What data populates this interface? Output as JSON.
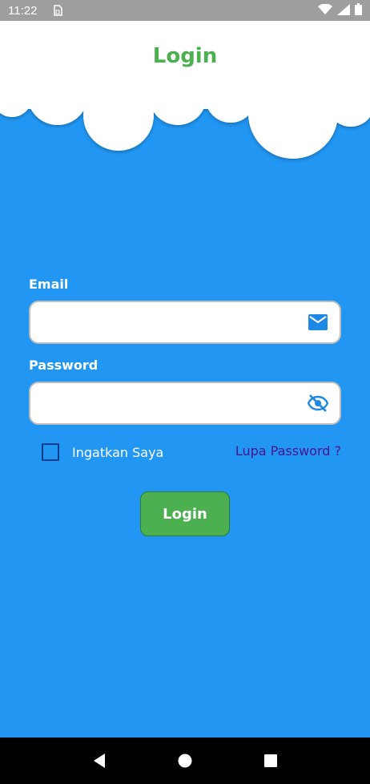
{
  "status_bar": {
    "time": "11:22",
    "icons": [
      "sim-card-icon",
      "wifi-icon",
      "signal-icon",
      "battery-icon"
    ]
  },
  "header": {
    "title": "Login",
    "title_color": "#4CAF50"
  },
  "form": {
    "email": {
      "label": "Email",
      "value": "",
      "placeholder": "",
      "icon": "mail-icon"
    },
    "password": {
      "label": "Password",
      "value": "",
      "placeholder": "",
      "icon": "eye-off-icon"
    },
    "remember": {
      "label": "Ingatkan Saya",
      "checked": false
    },
    "forgot_label": "Lupa Password ?",
    "login_label": "Login"
  },
  "nav_bar": {
    "buttons": [
      "back-icon",
      "home-icon",
      "recents-icon"
    ]
  },
  "colors": {
    "background": "#2196F3",
    "accent_green": "#4CAF50",
    "link_purple": "#4A148C",
    "icon_blue": "#1E88E5"
  }
}
